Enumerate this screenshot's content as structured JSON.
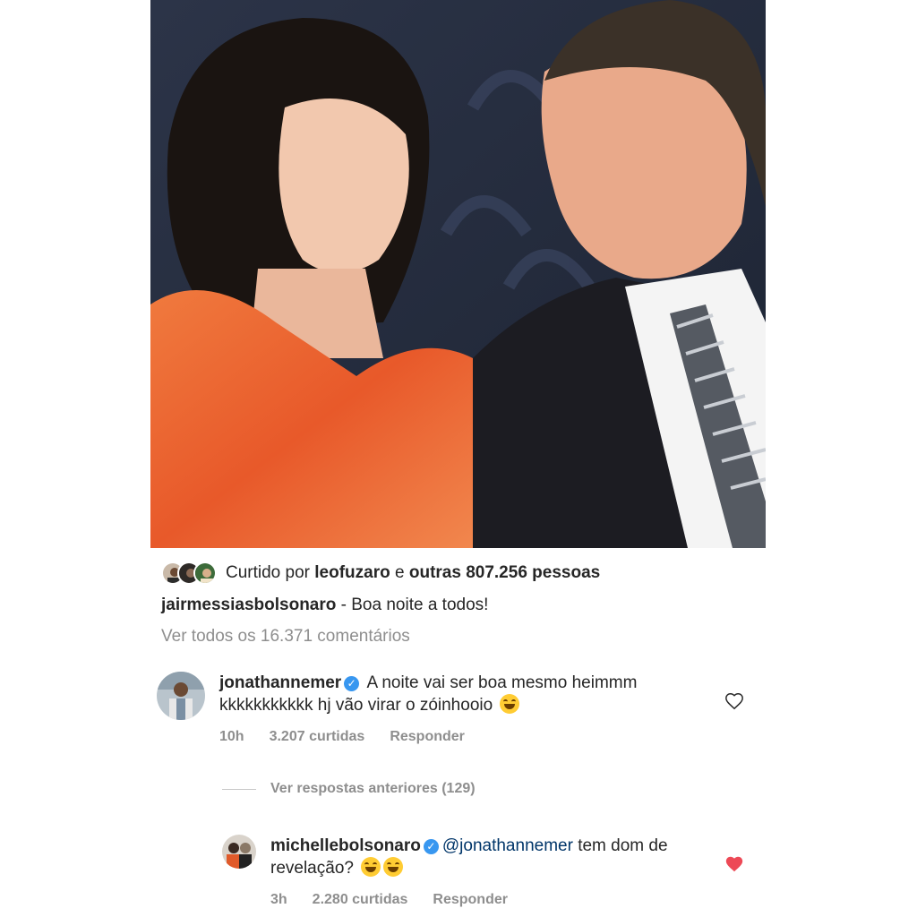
{
  "likes": {
    "prefix": "Curtido por ",
    "user": "leofuzaro",
    "connector": " e ",
    "others": "outras 807.256 pessoas"
  },
  "caption": {
    "user": "jairmessiasbolsonaro",
    "text": " - Boa noite a todos!"
  },
  "view_all_comments": "Ver todos os 16.371 comentários",
  "comments": [
    {
      "user": "jonathannemer",
      "verified": true,
      "text": "A noite vai ser boa mesmo heimmm kkkkkkkkkkk hj vão virar o zóinhooio",
      "emoji": "face-with-tears-of-joy",
      "time": "10h",
      "likes": "3.207 curtidas",
      "reply_label": "Responder",
      "liked": false
    },
    {
      "user": "michellebolsonaro",
      "verified": true,
      "mention": "@jonathannemer",
      "text": " tem dom de revelação?",
      "emoji": "face-with-tears-of-joy",
      "time": "3h",
      "likes": "2.280 curtidas",
      "reply_label": "Responder",
      "liked": true
    }
  ],
  "replies_toggle": "Ver respostas anteriores (129)",
  "colors": {
    "verified": "#3897f0",
    "heart_liked": "#ed4956",
    "muted_text": "#8e8e8e"
  }
}
